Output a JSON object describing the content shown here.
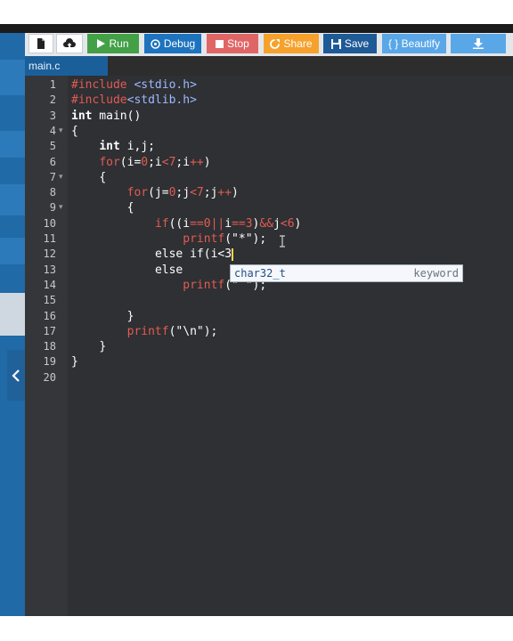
{
  "toolbar": {
    "buttons": [
      {
        "label": "",
        "icon": "new-file-icon"
      },
      {
        "label": "",
        "icon": "upload-cloud-icon"
      },
      {
        "label": "Run",
        "icon": "play-icon",
        "color": "#43a047"
      },
      {
        "label": "Debug",
        "icon": "debug-icon",
        "color": "#1e73be"
      },
      {
        "label": "Stop",
        "icon": "stop-icon",
        "color": "#e06666"
      },
      {
        "label": "Share",
        "icon": "share-icon",
        "color": "#f6a12c"
      },
      {
        "label": "Save",
        "icon": "save-icon",
        "color": "#1e5a96"
      },
      {
        "label": "{ } Beautify",
        "icon": "",
        "color": "#5aa7e8"
      },
      {
        "label": "",
        "icon": "download-icon",
        "color": "#5aa7e8"
      }
    ]
  },
  "tab": {
    "name": "main.c"
  },
  "editor": {
    "lines": [
      {
        "n": "1",
        "indent": 0,
        "tokens": [
          [
            "pre",
            "#include"
          ],
          [
            "txt",
            " "
          ],
          [
            "inc",
            "<stdio.h>"
          ]
        ]
      },
      {
        "n": "2",
        "indent": 0,
        "tokens": [
          [
            "pre",
            "#include"
          ],
          [
            "inc",
            "<stdlib.h>"
          ]
        ]
      },
      {
        "n": "3",
        "indent": 0,
        "tokens": [
          [
            "type",
            "int"
          ],
          [
            "txt",
            " main()"
          ]
        ]
      },
      {
        "n": "4",
        "indent": 0,
        "fold": true,
        "tokens": [
          [
            "txt",
            "{"
          ]
        ]
      },
      {
        "n": "5",
        "indent": 1,
        "tokens": [
          [
            "type",
            "int"
          ],
          [
            "txt",
            " i,j;"
          ]
        ]
      },
      {
        "n": "6",
        "indent": 1,
        "tokens": [
          [
            "ctrl",
            "for"
          ],
          [
            "txt",
            "(i="
          ],
          [
            "num",
            "0"
          ],
          [
            "txt",
            ";i"
          ],
          [
            "ctrl",
            "<"
          ],
          [
            "num",
            "7"
          ],
          [
            "txt",
            ";i"
          ],
          [
            "ctrl",
            "++"
          ],
          [
            "txt",
            ")"
          ]
        ]
      },
      {
        "n": "7",
        "indent": 1,
        "fold": true,
        "tokens": [
          [
            "txt",
            "{"
          ]
        ]
      },
      {
        "n": "8",
        "indent": 2,
        "tokens": [
          [
            "ctrl",
            "for"
          ],
          [
            "txt",
            "(j="
          ],
          [
            "num",
            "0"
          ],
          [
            "txt",
            ";j"
          ],
          [
            "ctrl",
            "<"
          ],
          [
            "num",
            "7"
          ],
          [
            "txt",
            ";j"
          ],
          [
            "ctrl",
            "++"
          ],
          [
            "txt",
            ")"
          ]
        ]
      },
      {
        "n": "9",
        "indent": 2,
        "fold": true,
        "tokens": [
          [
            "txt",
            "{"
          ]
        ]
      },
      {
        "n": "10",
        "indent": 3,
        "tokens": [
          [
            "ctrl",
            "if"
          ],
          [
            "txt",
            "((i"
          ],
          [
            "ctrl",
            "=="
          ],
          [
            "num",
            "0"
          ],
          [
            "ctrl",
            "||"
          ],
          [
            "txt",
            "i"
          ],
          [
            "ctrl",
            "=="
          ],
          [
            "num",
            "3"
          ],
          [
            "txt",
            ")"
          ],
          [
            "ctrl",
            "&&"
          ],
          [
            "txt",
            "j"
          ],
          [
            "ctrl",
            "<"
          ],
          [
            "num",
            "6"
          ],
          [
            "txt",
            ")"
          ]
        ]
      },
      {
        "n": "11",
        "indent": 4,
        "tokens": [
          [
            "fn",
            "printf"
          ],
          [
            "txt",
            "(\"*\");"
          ]
        ]
      },
      {
        "n": "12",
        "indent": 3,
        "cursor": true,
        "tokens": [
          [
            "txt",
            "else if(i<3"
          ]
        ]
      },
      {
        "n": "13",
        "indent": 3,
        "tokens": [
          [
            "txt",
            "else"
          ]
        ]
      },
      {
        "n": "14",
        "indent": 4,
        "tokens": [
          [
            "fn",
            "printf"
          ],
          [
            "txt",
            "(\" \");"
          ]
        ]
      },
      {
        "n": "15",
        "indent": 0,
        "tokens": []
      },
      {
        "n": "16",
        "indent": 2,
        "tokens": [
          [
            "txt",
            "}"
          ]
        ]
      },
      {
        "n": "17",
        "indent": 2,
        "tokens": [
          [
            "fn",
            "printf"
          ],
          [
            "txt",
            "(\"\\n\");"
          ]
        ]
      },
      {
        "n": "18",
        "indent": 1,
        "tokens": [
          [
            "txt",
            "}"
          ]
        ]
      },
      {
        "n": "19",
        "indent": 0,
        "tokens": [
          [
            "txt",
            "}"
          ]
        ]
      },
      {
        "n": "20",
        "indent": 0,
        "tokens": []
      }
    ]
  },
  "autocomplete": {
    "word": "char32_t",
    "kind": "keyword"
  },
  "sidebar": {
    "collapse_icon": "chevron-left-icon"
  }
}
